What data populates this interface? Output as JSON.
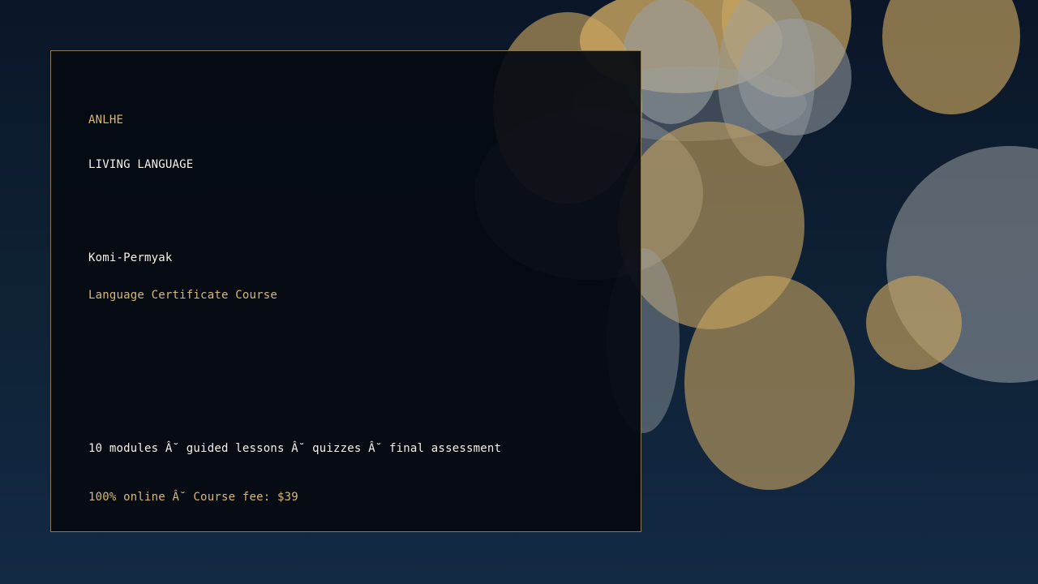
{
  "card": {
    "brand": "ANLHE",
    "category": "LIVING LANGUAGE",
    "language": "Komi-Permyak",
    "course_title": "Language Certificate Course",
    "features": "10 modules Â˘ guided lessons Â˘ quizzes Â˘ final assessment",
    "pricing": "100% online Â˘ Course fee: $39"
  },
  "colors": {
    "background": "#0f2236",
    "accent_gold": "#d8b878",
    "text_white": "#f4f1ea",
    "card_border": "#8a7a52"
  }
}
